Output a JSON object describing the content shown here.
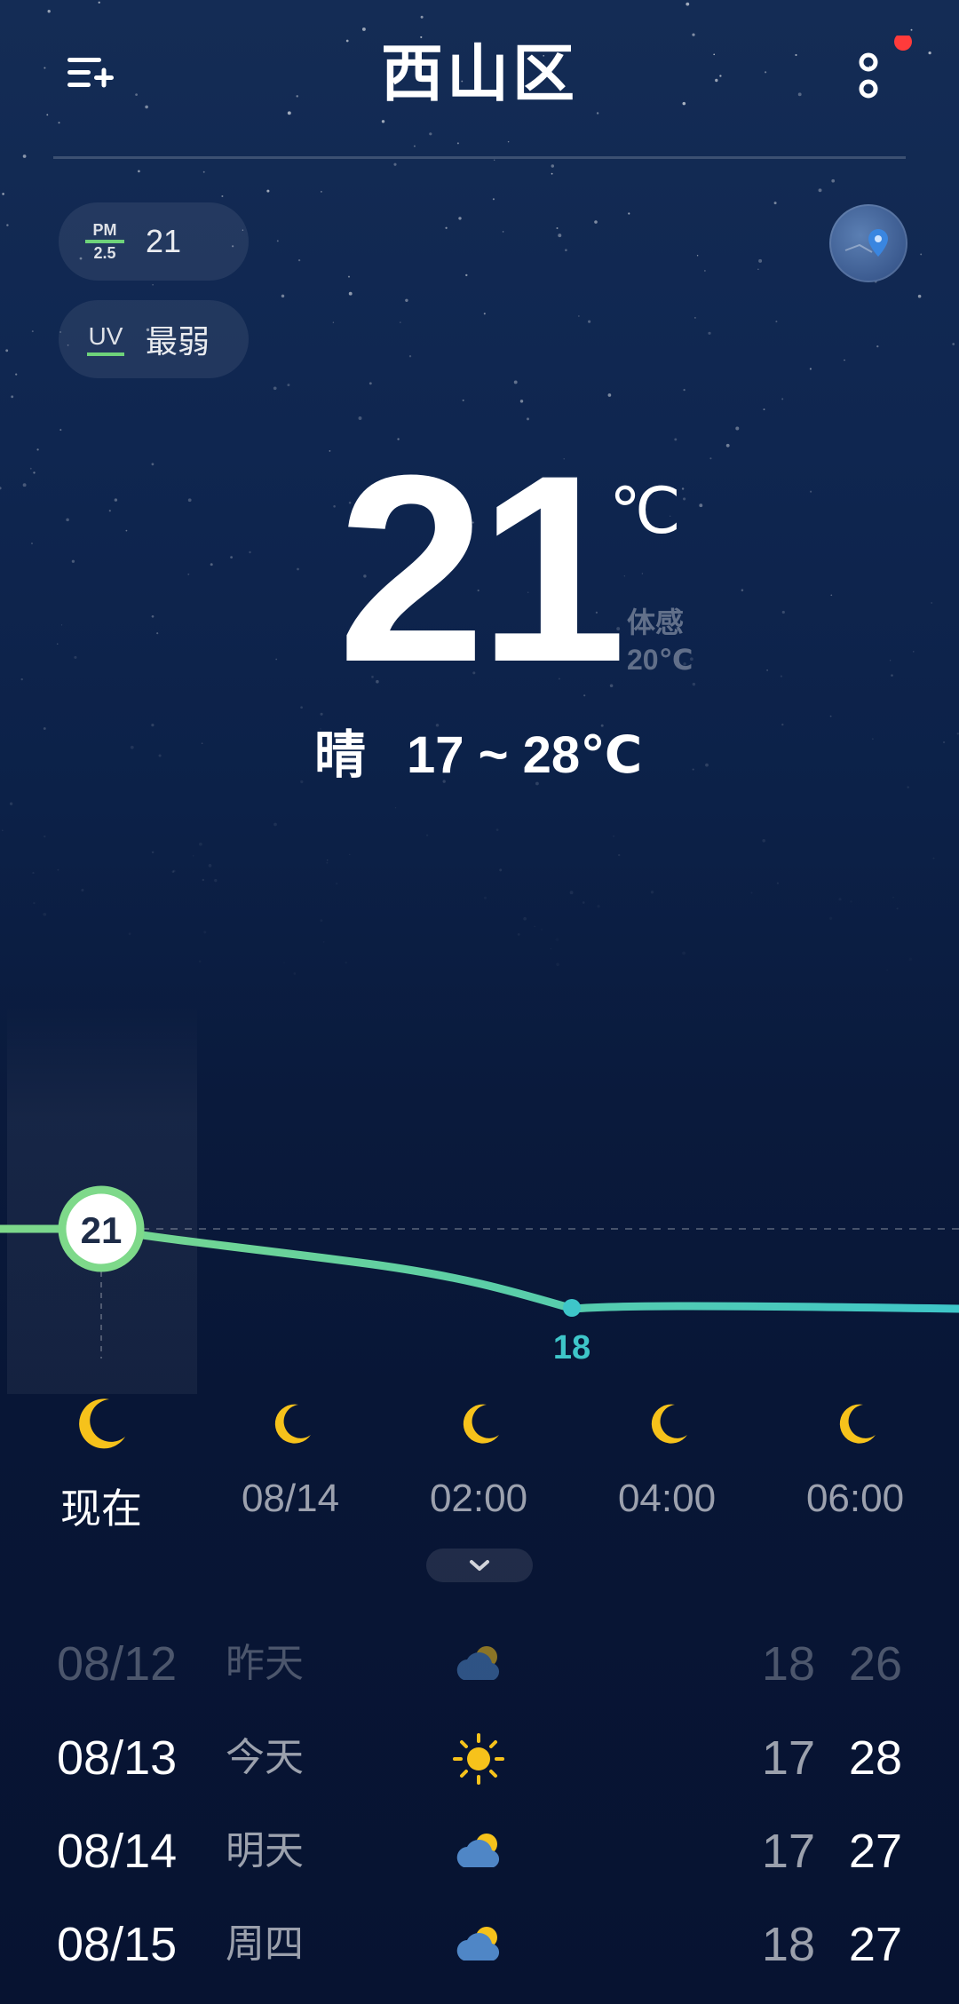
{
  "header": {
    "city": "西山区",
    "menu_icon": "add-city-icon",
    "more_icon": "more-options-icon",
    "notification_dot_color": "#ff3b3b"
  },
  "air": {
    "pm_label_top": "PM",
    "pm_label_bottom": "2.5",
    "pm_value": "21",
    "uv_label": "UV",
    "uv_value": "最弱"
  },
  "current": {
    "temp": "21",
    "unit": "℃",
    "feels_label": "体感",
    "feels_value": "20℃",
    "condition": "晴",
    "range": "17 ~ 28℃"
  },
  "hourly": {
    "current_temp_label": "21",
    "min_temp_label": "18",
    "temps": [
      21,
      20,
      19.5,
      18,
      18,
      18
    ],
    "items": [
      {
        "label": "现在",
        "icon": "moon-icon"
      },
      {
        "label": "08/14",
        "icon": "moon-icon"
      },
      {
        "label": "02:00",
        "icon": "moon-icon"
      },
      {
        "label": "04:00",
        "icon": "moon-icon"
      },
      {
        "label": "06:00",
        "icon": "moon-icon"
      }
    ],
    "line_color_start": "#7ed98a",
    "line_color_end": "#3ec6c9"
  },
  "daily": [
    {
      "date": "08/12",
      "day": "昨天",
      "icon": "partly-cloudy-icon",
      "low": "18",
      "high": "26"
    },
    {
      "date": "08/13",
      "day": "今天",
      "icon": "sun-icon",
      "low": "17",
      "high": "28"
    },
    {
      "date": "08/14",
      "day": "明天",
      "icon": "partly-cloudy-icon",
      "low": "17",
      "high": "27"
    },
    {
      "date": "08/15",
      "day": "周四",
      "icon": "partly-cloudy-icon",
      "low": "18",
      "high": "27"
    }
  ],
  "colors": {
    "sun": "#f6c21b",
    "cloud": "#4f86c6",
    "accent_green": "#6ed37a"
  }
}
